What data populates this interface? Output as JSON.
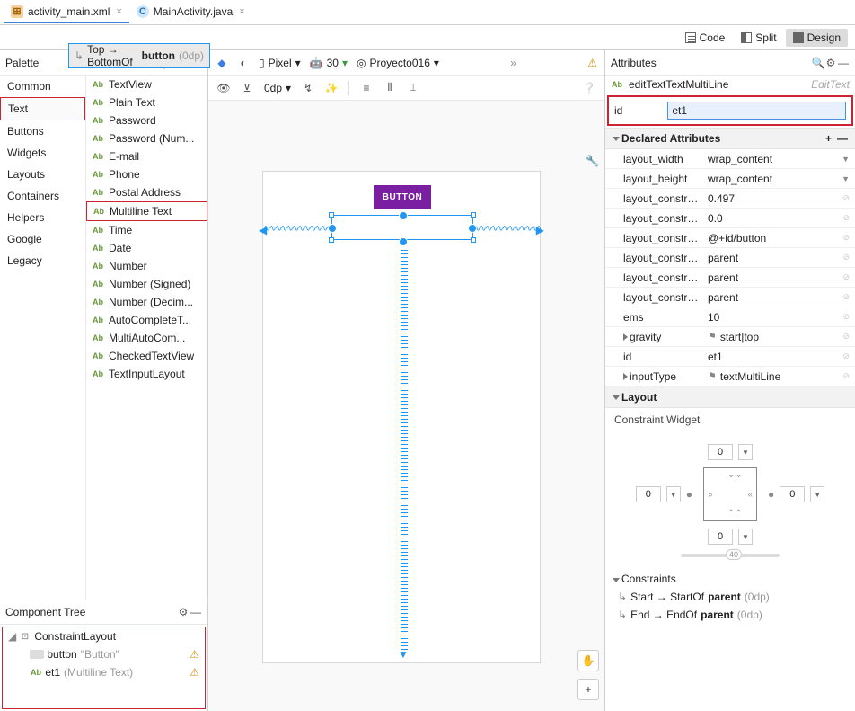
{
  "tabs": [
    {
      "name": "activity_main.xml",
      "active": true
    },
    {
      "name": "MainActivity.java",
      "active": false
    }
  ],
  "view_modes": [
    {
      "l": "Code"
    },
    {
      "l": "Split"
    },
    {
      "l": "Design",
      "active": true
    }
  ],
  "palette": {
    "title": "Palette",
    "categories": [
      "Common",
      "Text",
      "Buttons",
      "Widgets",
      "Layouts",
      "Containers",
      "Helpers",
      "Google",
      "Legacy"
    ],
    "selected_cat": "Text",
    "items": [
      "TextView",
      "Plain Text",
      "Password",
      "Password (Num...",
      "E-mail",
      "Phone",
      "Postal Address",
      "Multiline Text",
      "Time",
      "Date",
      "Number",
      "Number (Signed)",
      "Number (Decim...",
      "AutoCompleteT...",
      "MultiAutoCom...",
      "CheckedTextView",
      "TextInputLayout"
    ],
    "highlight_item": "Multiline Text"
  },
  "tree": {
    "title": "Component Tree",
    "root": "ConstraintLayout",
    "children": [
      {
        "name": "button",
        "sub": "\"Button\"",
        "warn": true
      },
      {
        "name": "et1",
        "sub": "(Multiline Text)",
        "warn": true
      }
    ]
  },
  "canvas": {
    "toolbar": {
      "device": "Pixel",
      "api": "30",
      "theme": "Proyecto016",
      "zoom": "0dp"
    },
    "button_label": "BUTTON"
  },
  "attrs": {
    "title": "Attributes",
    "elem": "editTextTextMultiLine",
    "cls": "EditText",
    "id_label": "id",
    "id_value": "et1",
    "declared": "Declared Attributes",
    "rows": [
      {
        "k": "layout_width",
        "v": "wrap_content",
        "dd": true
      },
      {
        "k": "layout_height",
        "v": "wrap_content",
        "dd": true
      },
      {
        "k": "layout_constrai...",
        "v": "0.497"
      },
      {
        "k": "layout_constrai...",
        "v": "0.0"
      },
      {
        "k": "layout_constrai...",
        "v": "@+id/button"
      },
      {
        "k": "layout_constrai...",
        "v": "parent"
      },
      {
        "k": "layout_constrai...",
        "v": "parent"
      },
      {
        "k": "layout_constrai...",
        "v": "parent"
      },
      {
        "k": "ems",
        "v": "10"
      },
      {
        "k": "gravity",
        "v": "start|top",
        "flag": true,
        "arr": true
      },
      {
        "k": "id",
        "v": "et1"
      },
      {
        "k": "inputType",
        "v": "textMultiLine",
        "flag": true,
        "arr": true
      }
    ],
    "layout": "Layout",
    "cw_label": "Constraint Widget",
    "cw_vals": {
      "top": "0",
      "left": "0",
      "right": "0",
      "bottom": "0"
    },
    "constraints_label": "Constraints",
    "constraints": [
      {
        "t": "Start → StartOf ",
        "b": "parent",
        "s": " (0dp)"
      },
      {
        "t": "End → EndOf ",
        "b": "parent",
        "s": " (0dp)"
      },
      {
        "t": "Top → BottomOf ",
        "b": "button",
        "s": " (0dp)",
        "sel": true
      }
    ]
  }
}
